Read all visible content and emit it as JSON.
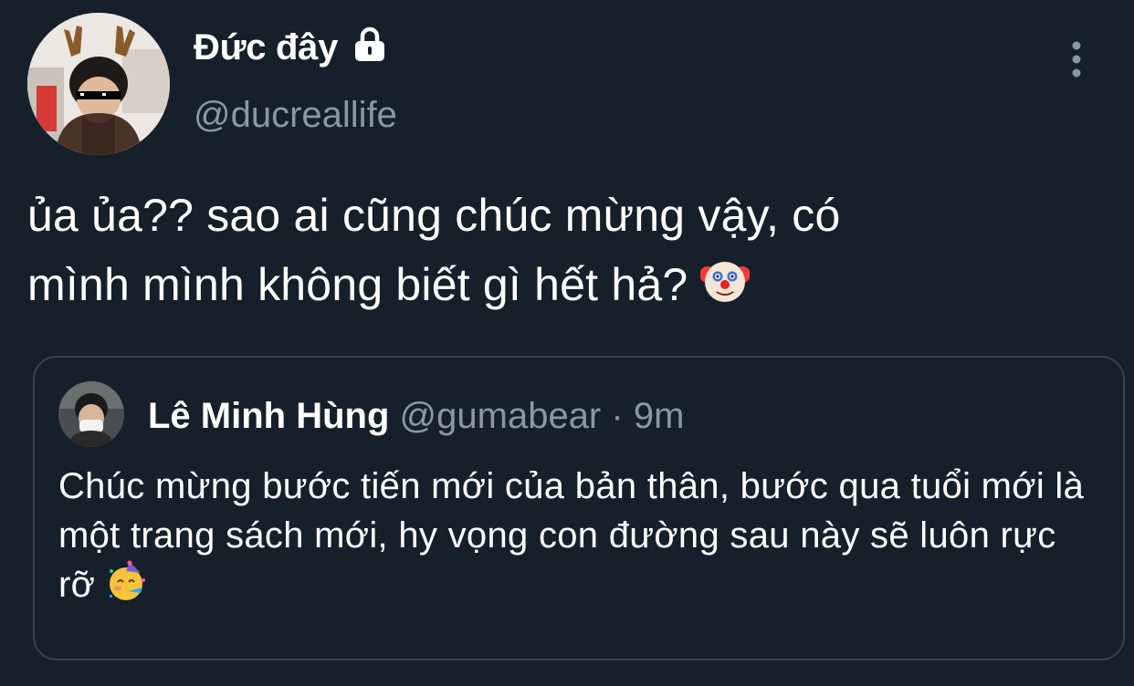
{
  "author": {
    "display_name": "Đức đây",
    "handle": "@ducreallife",
    "protected_icon": "lock-icon"
  },
  "menu_icon": "more-vertical-icon",
  "tweet": {
    "text": "ủa ủa?? sao ai cũng chúc mừng vậy, có\nmình mình không biết gì hết hả?",
    "emoji": "clown-face-emoji"
  },
  "quote": {
    "display_name": "Lê Minh Hùng",
    "handle": "@gumabear",
    "separator": "·",
    "time": "9m",
    "text": "Chúc mừng bước tiến mới của bản thân, bước qua tuổi mới là một trang sách mới, hy vọng con đường sau này sẽ luôn rực rỡ",
    "emoji": "partying-face-emoji"
  },
  "colors": {
    "background": "#15202b",
    "text": "#ffffff",
    "secondary_text": "#8899a6",
    "border": "#38444d"
  }
}
